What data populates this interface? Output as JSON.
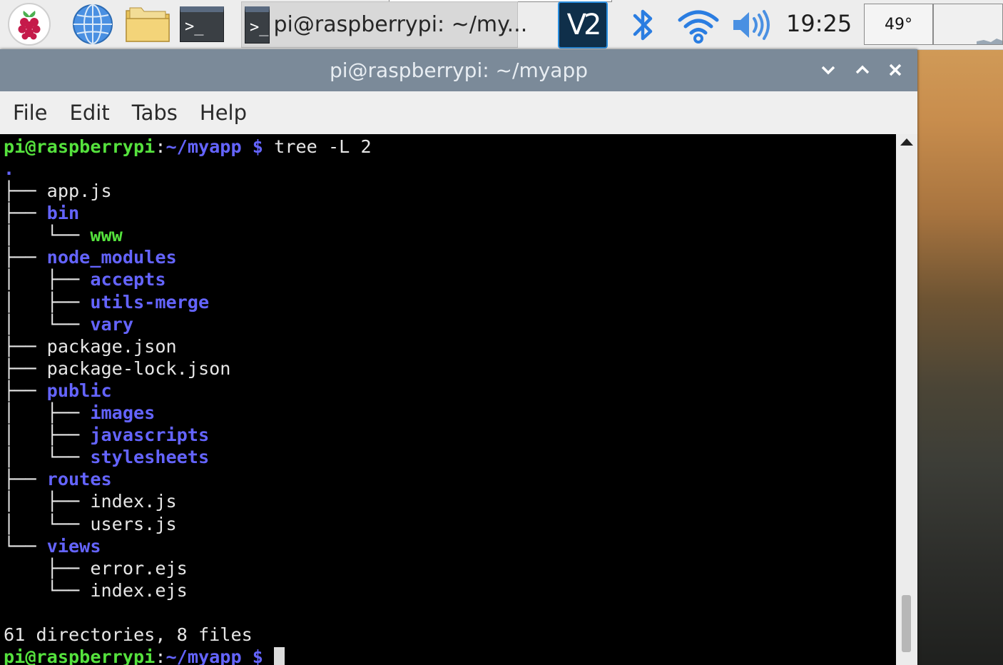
{
  "taskbar": {
    "terminal_glyph": ">_",
    "active_task_label": "pi@raspberrypi: ~/my...",
    "vnc_label": "V2",
    "clock": "19:25",
    "cpu_temp": "49°"
  },
  "window": {
    "title": "pi@raspberrypi: ~/myapp",
    "minimize_glyph": "⌄",
    "maximize_glyph": "⌃",
    "close_glyph": "✕"
  },
  "menu": {
    "file": "File",
    "edit": "Edit",
    "tabs": "Tabs",
    "help": "Help"
  },
  "terminal": {
    "prompt_user": "pi@raspberrypi",
    "prompt_sep": ":",
    "prompt_path": "~/myapp",
    "prompt_symbol": " $",
    "command": " tree -L 2",
    "root": ".",
    "tree": [
      {
        "prefix": "├── ",
        "name": "app.js",
        "kind": "file"
      },
      {
        "prefix": "├── ",
        "name": "bin",
        "kind": "dir"
      },
      {
        "prefix": "│   └── ",
        "name": "www",
        "kind": "exe"
      },
      {
        "prefix": "├── ",
        "name": "node_modules",
        "kind": "dir"
      },
      {
        "prefix": "│   ├── ",
        "name": "accepts",
        "kind": "dir"
      },
      {
        "prefix": "│   ├── ",
        "name": "utils-merge",
        "kind": "dir"
      },
      {
        "prefix": "│   └── ",
        "name": "vary",
        "kind": "dir"
      },
      {
        "prefix": "├── ",
        "name": "package.json",
        "kind": "file"
      },
      {
        "prefix": "├── ",
        "name": "package-lock.json",
        "kind": "file"
      },
      {
        "prefix": "├── ",
        "name": "public",
        "kind": "dir"
      },
      {
        "prefix": "│   ├── ",
        "name": "images",
        "kind": "dir"
      },
      {
        "prefix": "│   ├── ",
        "name": "javascripts",
        "kind": "dir"
      },
      {
        "prefix": "│   └── ",
        "name": "stylesheets",
        "kind": "dir"
      },
      {
        "prefix": "├── ",
        "name": "routes",
        "kind": "dir"
      },
      {
        "prefix": "│   ├── ",
        "name": "index.js",
        "kind": "file"
      },
      {
        "prefix": "│   └── ",
        "name": "users.js",
        "kind": "file"
      },
      {
        "prefix": "└── ",
        "name": "views",
        "kind": "dir"
      },
      {
        "prefix": "    ├── ",
        "name": "error.ejs",
        "kind": "file"
      },
      {
        "prefix": "    └── ",
        "name": "index.ejs",
        "kind": "file"
      }
    ],
    "summary": "61 directories, 8 files"
  },
  "colors": {
    "prompt_user": "#55e23d",
    "prompt_path": "#6464ff",
    "directory": "#6464ff",
    "executable": "#55e23d",
    "titlebar": "#7b8a99"
  },
  "icons": [
    "raspberry-pi-icon",
    "globe-icon",
    "folder-icon",
    "terminal-icon",
    "vnc-icon",
    "bluetooth-icon",
    "wifi-icon",
    "volume-icon"
  ]
}
